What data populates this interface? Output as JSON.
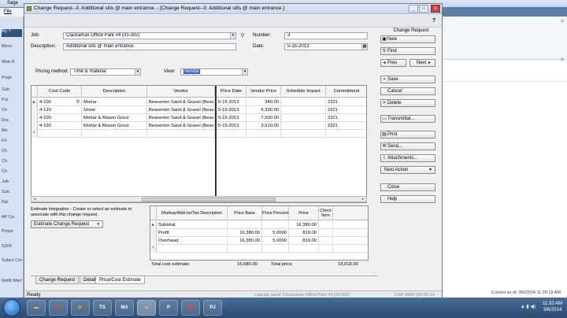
{
  "background": {
    "app_title": "Sage",
    "menu_item": "File",
    "left_items": [
      "My T",
      "Micro",
      "Web R",
      "Proje",
      "Sub",
      "Pur",
      "Ch",
      "Dra",
      "Me",
      "Fil",
      "Ch",
      "Ch",
      "Ch",
      "Job",
      "Sub",
      "Del",
      "AP Ca",
      "Prope",
      "S300",
      "Subco Comp",
      "Notifi Warni"
    ],
    "status_right": "Current as of: 3/6/2014 11:26:19 AM"
  },
  "dialog": {
    "title": "Change Request--3: Additional sills @ main entrance. - [Change Request--3: Additional sills @ main entrance.]",
    "window_buttons": {
      "min": "_",
      "max": "□",
      "close": "x"
    },
    "help_label": "?",
    "job_label": "Job:",
    "job_value": "Clackamas Office Park #4 (03-002)",
    "number_label": "Number:",
    "number_value": "3",
    "description_label": "Description:",
    "description_value": "Additional sills @ main entrance.",
    "date_label": "Date:",
    "date_value": "5-15-2013",
    "pricing_method_label": "Pricing method:",
    "pricing_method_value": "Time & material",
    "view_label": "View:",
    "view_value": "Vendor"
  },
  "grid": {
    "columns": [
      "Cost Code",
      "Description",
      "Vendor",
      "Price Date",
      "Vendor Price",
      "Schedule Impact",
      "Commitment"
    ],
    "rows": [
      {
        "cost_code": "4-100",
        "description": "Mortar",
        "vendor": "Beaverton Sand & Gravel (Beav",
        "price_date": "5-15-2013",
        "vendor_price": "340.00",
        "schedule_impact": "",
        "commitment": "2321"
      },
      {
        "cost_code": "4-120",
        "description": "Stone",
        "vendor": "Beaverton Sand & Gravel (Beav",
        "price_date": "5-15-2013",
        "vendor_price": "5,330.00",
        "schedule_impact": "",
        "commitment": "2321"
      },
      {
        "cost_code": "4-100",
        "description": "Mortar & Mason Grout",
        "vendor": "Beaverton Sand & Gravel (Beav",
        "price_date": "5-15-2013",
        "vendor_price": "7,500.00",
        "schedule_impact": "",
        "commitment": "2321"
      },
      {
        "cost_code": "4-100",
        "description": "Mortar & Mason Grout",
        "vendor": "Beaverton Sand & Gravel (Beav",
        "price_date": "5-15-2013",
        "vendor_price": "3,510.00",
        "schedule_impact": "",
        "commitment": "2321"
      }
    ],
    "new_row_marker": "*"
  },
  "right_panel": {
    "title": "Change Request",
    "new": "New",
    "find": "Find",
    "prev": "Prev",
    "next": "Next",
    "save": "Save",
    "cancel": "Cancel",
    "delete": "Delete",
    "transmittal": "Transmittal...",
    "print": "Print",
    "send": "Send...",
    "attachments": "Attachments...",
    "next_action": "Next Action",
    "close": "Close",
    "help": "Help"
  },
  "estimate": {
    "text": "Estimate integration - Create or select an estimate to associate with this change request.",
    "button": "Estimate Change Request"
  },
  "markup": {
    "columns": [
      "Markup/Add-on/Tax Description",
      "Price Base",
      "Price Percent",
      "Price",
      "Chtrct Item"
    ],
    "rows": [
      {
        "description": "Subtotal",
        "price_base": "",
        "price_percent": "",
        "price": "16,380.00",
        "item": ""
      },
      {
        "description": "Profit",
        "price_base": "16,380.00",
        "price_percent": "5.0000",
        "price": "819.00",
        "item": ""
      },
      {
        "description": "Overhead",
        "price_base": "16,380.00",
        "price_percent": "5.0000",
        "price": "819.00",
        "item": ""
      }
    ],
    "total_cost_label": "Total cost estimate:",
    "total_cost_value": "16,680.00",
    "total_price_label": "Total price:",
    "total_price_value": "18,018.00"
  },
  "tabs": [
    "Change Request",
    "Detail",
    "Price/Cost Estimate"
  ],
  "status": {
    "left": "Ready",
    "last_job": "Last job used: Clackamas Office Park #4 (03-002)",
    "last_job_extra": "CAP-3689 (03-06-14"
  },
  "taskbar": {
    "apps": [
      "",
      "",
      "",
      "TS",
      "MA",
      "",
      "P",
      "",
      "PJ"
    ],
    "time": "11:32 AM",
    "date": "3/6/2014"
  }
}
